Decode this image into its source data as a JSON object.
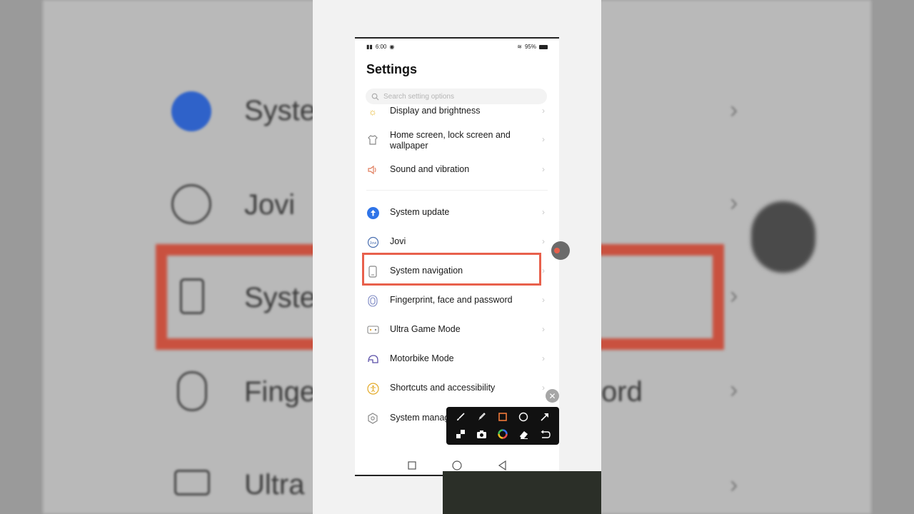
{
  "status_bar": {
    "time": "6:00",
    "battery": "95%"
  },
  "page_title": "Settings",
  "search": {
    "placeholder": "Search setting options"
  },
  "items": [
    {
      "label": "Display and brightness",
      "icon": "sun-icon"
    },
    {
      "label": "Home screen, lock screen and wallpaper",
      "icon": "tshirt-icon"
    },
    {
      "label": "Sound and vibration",
      "icon": "speaker-icon"
    },
    {
      "label": "System update",
      "icon": "update-arrow-icon"
    },
    {
      "label": "Jovi",
      "icon": "jovi-icon"
    },
    {
      "label": "System navigation",
      "icon": "phone-icon"
    },
    {
      "label": "Fingerprint, face and password",
      "icon": "fingerprint-icon"
    },
    {
      "label": "Ultra Game Mode",
      "icon": "gamepad-icon"
    },
    {
      "label": "Motorbike Mode",
      "icon": "helmet-icon"
    },
    {
      "label": "Shortcuts and accessibility",
      "icon": "accessibility-icon"
    },
    {
      "label": "System management",
      "icon": "hexagon-gear-icon"
    }
  ],
  "background_labels": {
    "system_update": "Syste",
    "jovi": "Jovi",
    "system_navigation": "Syste",
    "fingerprint": "Finge",
    "fingerprint_tail": "ord",
    "ultra": "Ultra"
  },
  "highlight_color": "#e8604c",
  "toolbar_tools": [
    "brush-icon",
    "highlighter-icon",
    "rectangle-icon",
    "circle-icon",
    "arrow-icon",
    "mosaic-icon",
    "camera-icon",
    "color-wheel-icon",
    "eraser-icon",
    "undo-icon"
  ]
}
